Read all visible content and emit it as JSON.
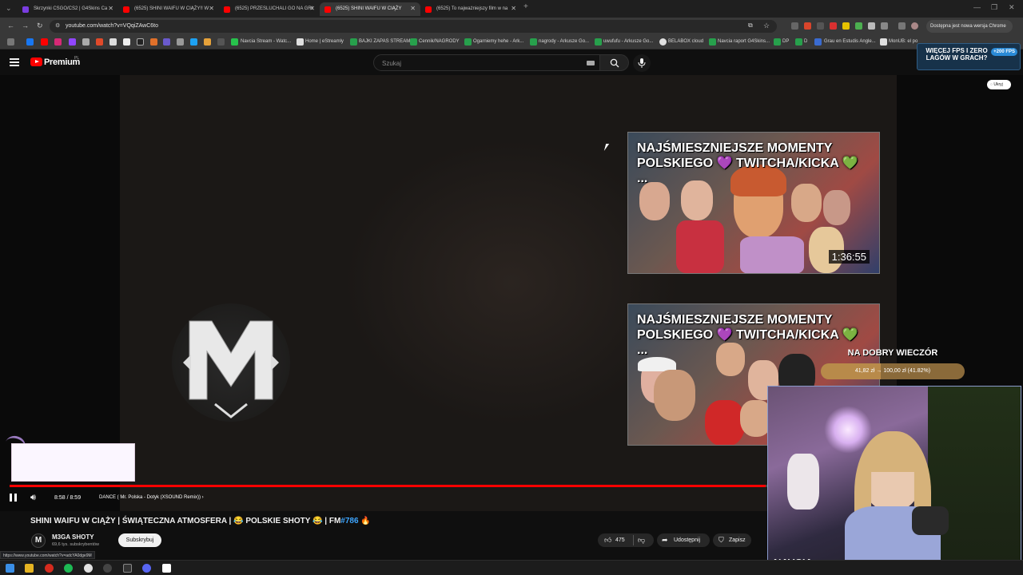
{
  "browser": {
    "tabs": [
      {
        "title": "Skrzynki CSGO/CS2 | G4Skins Ca",
        "color": "#7a3de0",
        "active": false
      },
      {
        "title": "(6525) SHINI WAIFU W CIĄŻY!! W",
        "color": "#ff0000",
        "active": false
      },
      {
        "title": "(6525) PRZESLUCHALI GO NA GRI",
        "color": "#ff0000",
        "active": false
      },
      {
        "title": "(6525) SHINI WAIFU W CIĄŻY",
        "color": "#ff0000",
        "active": true
      },
      {
        "title": "(6525) To najważniejszy film w na",
        "color": "#ff0000",
        "active": false
      }
    ],
    "new_tab": "+",
    "url": "youtube.com/watch?v=VQqiZAwC6to",
    "chrome_update": "Dostępna jest nowa wersja Chrome",
    "bookmarks": [
      {
        "label": "Navcia Stream - Watc...",
        "color": "#27c24c"
      },
      {
        "label": "Home | eStreamly",
        "color": "#e0e0e0"
      },
      {
        "label": "BAJKI ZAPAS STREAM",
        "color": "#27a04c"
      },
      {
        "label": "Cennik/NAGRODY",
        "color": "#27a04c"
      },
      {
        "label": "Ogarniemy hehe - Ark...",
        "color": "#27a04c"
      },
      {
        "label": "nagrody - Arkusze Go...",
        "color": "#27a04c"
      },
      {
        "label": "uwufufu - Arkusze Go...",
        "color": "#27a04c"
      },
      {
        "label": "BELABOX cloud",
        "color": "#e0e0e0"
      },
      {
        "label": "Navcia raport G4Skins...",
        "color": "#27a04c"
      },
      {
        "label": "DP",
        "color": "#27a04c"
      },
      {
        "label": "D",
        "color": "#27a04c"
      },
      {
        "label": "Grau en Estudis Angle...",
        "color": "#3a6bd0"
      },
      {
        "label": "MonUB: el po",
        "color": "#e0e0e0"
      }
    ],
    "status_url": "https://www.youtube.com/watch?v=adcYA0dge9M"
  },
  "youtube": {
    "logo_text": "Premium",
    "region": "PL",
    "search_placeholder": "Szukaj",
    "video_title_main": "SHINI WAIFU W CIĄŻY | ŚWIĄTECZNA ATMOSFERA | 😂 POLSKIE SHOTY 😂 | FM",
    "video_title_tag": "#786",
    "video_title_emoji": "🔥",
    "channel_initial": "M",
    "channel_name": "M3GA SHOTY",
    "channel_subs": "69,6 tys. subskrybentów",
    "subscribe": "Subskrybuj",
    "likes": "475",
    "share": "Udostępnij",
    "save": "Zapisz",
    "hide": "Ukryj"
  },
  "player": {
    "time": "8:58 / 8:59",
    "chapter": "DANCE ( Mr. Polska - Dotyk (XSOUND Remix))",
    "progress": 0.998,
    "endscreen": [
      {
        "title": "NAJŚMIESZNIEJSZE MOMENTY POLSKIEGO 💜 TWITCHA/KICKA 💚 ...",
        "duration": "1:36:55"
      },
      {
        "title": "NAJŚMIESZNIEJSZE MOMENTY POLSKIEGO 💜 TWITCHA/KICKA 💚 ...",
        "duration": ""
      }
    ]
  },
  "overlay": {
    "promo_text": "WIĘCEJ FPS I ZERO LAGÓW W GRACH?",
    "promo_badge": "+200 FPS",
    "goal_title": "NA DOBRY WIECZÓR",
    "goal_text": "41,82 zł → 100,00 zł (41.82%)",
    "goal_progress": 0.4182,
    "cam_name": "NAVCIA"
  },
  "colors": {
    "accent": "#ff0000",
    "link": "#3ea6ff"
  }
}
